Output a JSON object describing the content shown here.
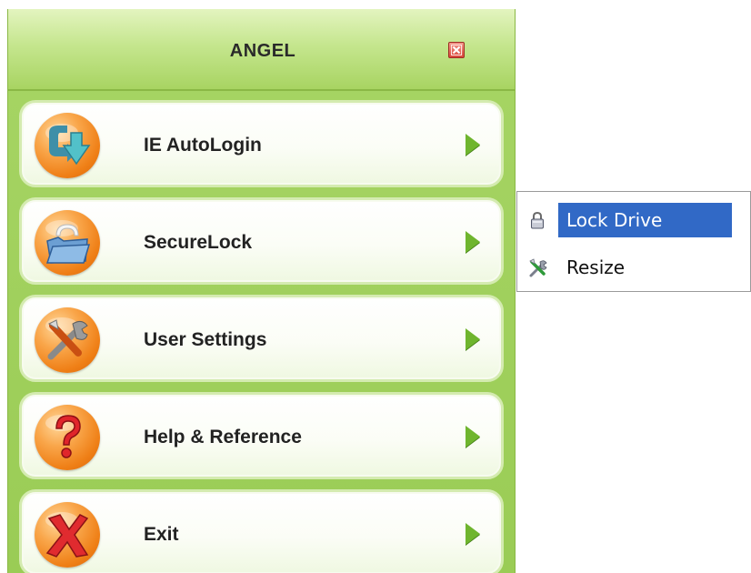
{
  "window": {
    "title": "ANGEL"
  },
  "menu": {
    "items": [
      {
        "label": "IE AutoLogin",
        "icon": "download-arrow-icon"
      },
      {
        "label": "SecureLock",
        "icon": "folder-lock-icon"
      },
      {
        "label": "User Settings",
        "icon": "tools-icon"
      },
      {
        "label": "Help & Reference",
        "icon": "question-mark-icon"
      },
      {
        "label": "Exit",
        "icon": "red-x-icon"
      }
    ]
  },
  "submenu": {
    "items": [
      {
        "label": "Lock Drive",
        "icon": "padlock-icon",
        "highlighted": true
      },
      {
        "label": "Resize",
        "icon": "wrench-screwdriver-icon",
        "highlighted": false
      }
    ]
  },
  "colors": {
    "panel_green": "#9acc55",
    "arrow_green": "#6fb52e",
    "orb_orange": "#ef7f16",
    "highlight_blue": "#3169c6"
  }
}
